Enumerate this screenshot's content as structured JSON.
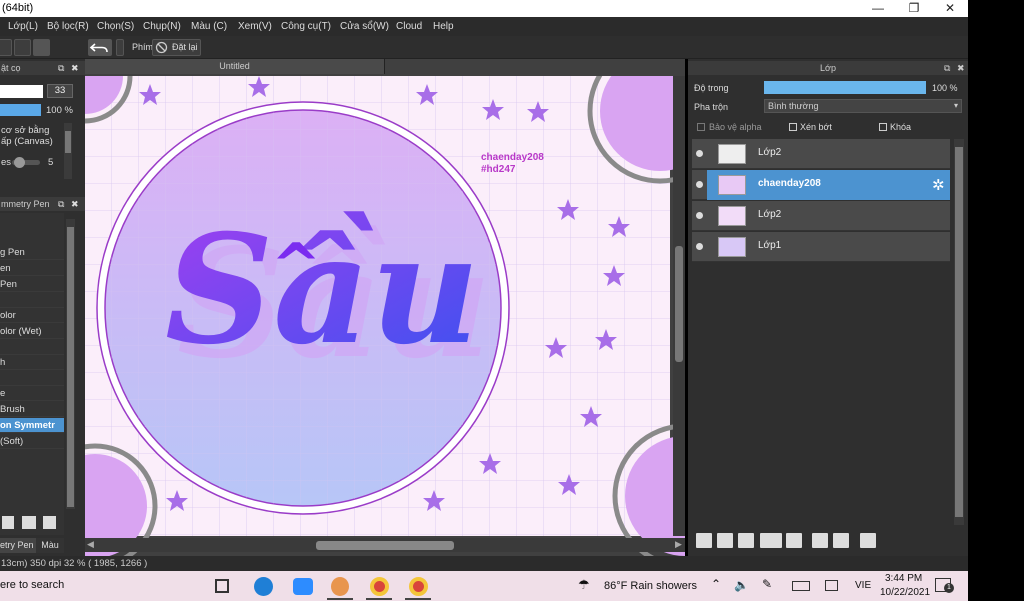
{
  "title_bar": {
    "title": "(64bit)"
  },
  "menu": [
    "Lớp(L)",
    "Bộ lọc(R)",
    "Chọn(S)",
    "Chụp(N)",
    "Màu (C)",
    "Xem(V)",
    "Công cụ(T)",
    "Cửa sổ(W)",
    "Cloud",
    "Help"
  ],
  "toolbar": {
    "phim_label": "Phím",
    "reset_label": "Đặt lại"
  },
  "brush_panel": {
    "title": "ật cọ",
    "size_value": "33",
    "opacity_value": "100 %",
    "option_line1": "cơ sở bằng",
    "option_line2": "ấp (Canvas)",
    "spacing_label": "es",
    "spacing_value": "5"
  },
  "brush_list": {
    "title": "mmetry Pen",
    "items": [
      "g Pen",
      "en",
      "Pen",
      "olor",
      "olor (Wet)",
      "h",
      "e",
      "Brush",
      "on Symmetr",
      "(Soft)"
    ],
    "selected_index": 8
  },
  "left_tabs": [
    "etry Pen",
    "Màu"
  ],
  "canvas": {
    "doc_title": "Untitled",
    "watermark_line1": "chaenday208",
    "watermark_line2": "#hd247",
    "art_text": "Sầu",
    "art_text_accent": "^"
  },
  "layer_panel": {
    "title": "Lớp",
    "opacity_label": "Độ trong",
    "opacity_value": "100 %",
    "blend_label": "Pha trộn",
    "blend_value": "Bình thường",
    "protect_alpha": "Bảo vệ alpha",
    "clip": "Xén bớt",
    "lock": "Khóa",
    "layers": [
      {
        "name": "Lớp2",
        "selected": false
      },
      {
        "name": "chaenday208",
        "selected": true
      },
      {
        "name": "Lớp2",
        "selected": false
      },
      {
        "name": "Lớp1",
        "selected": false
      }
    ]
  },
  "status_bar": {
    "text": "13cm) 350 dpi  32 %  ( 1985, 1266 )"
  },
  "taskbar": {
    "search_text": "ere to search",
    "weather": "86°F  Rain showers",
    "lang": "VIE",
    "time": "3:44 PM",
    "date": "10/22/2021",
    "notif_count": "1"
  },
  "colors": {
    "canvas_bg": "#fbeefa",
    "circle_fill_top": "#dcb0f5",
    "circle_fill_bottom": "#b7c6f7",
    "star": "#a86ee8",
    "text_main": "#7b2cf0",
    "watermark": "#b838c8",
    "layer_selected": "#4c93d0"
  }
}
